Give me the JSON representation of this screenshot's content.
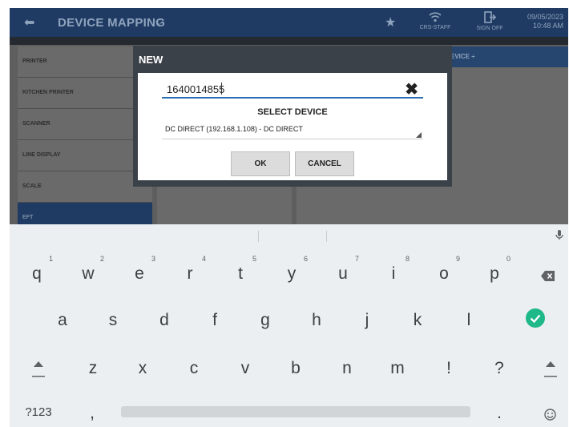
{
  "topbar": {
    "title": "DEVICE MAPPING",
    "staff_label": "CRS-STAFF",
    "signoff_label": "SIGN OFF",
    "date": "09/05/2023",
    "time": "10:48 AM",
    "back_icon": "back-arrow-icon",
    "star_icon": "star-icon"
  },
  "sidebar": {
    "items": [
      {
        "label": "PRINTER"
      },
      {
        "label": "KITCHEN PRINTER"
      },
      {
        "label": "SCANNER"
      },
      {
        "label": "LINE DISPLAY"
      },
      {
        "label": "SCALE"
      },
      {
        "label": "EFT"
      }
    ]
  },
  "right_panel": {
    "header": "EVICE ÷"
  },
  "dialog": {
    "title": "NEW",
    "input_value": "1640014855",
    "select_label": "SELECT DEVICE",
    "selected_device": "DC DIRECT (192.168.1.108) - DC DIRECT",
    "ok_label": "OK",
    "cancel_label": "CANCEL"
  },
  "keyboard": {
    "row1": [
      {
        "key": "q",
        "num": "1"
      },
      {
        "key": "w",
        "num": "2"
      },
      {
        "key": "e",
        "num": "3"
      },
      {
        "key": "r",
        "num": "4"
      },
      {
        "key": "t",
        "num": "5"
      },
      {
        "key": "y",
        "num": "6"
      },
      {
        "key": "u",
        "num": "7"
      },
      {
        "key": "i",
        "num": "8"
      },
      {
        "key": "o",
        "num": "9"
      },
      {
        "key": "p",
        "num": "0"
      }
    ],
    "row2": [
      "a",
      "s",
      "d",
      "f",
      "g",
      "h",
      "j",
      "k",
      "l"
    ],
    "row3": [
      "z",
      "x",
      "c",
      "v",
      "b",
      "n",
      "m",
      "!",
      "?"
    ],
    "symbols_label": "?123",
    "comma": ",",
    "period": ".",
    "accent_color": "#1fb889"
  }
}
